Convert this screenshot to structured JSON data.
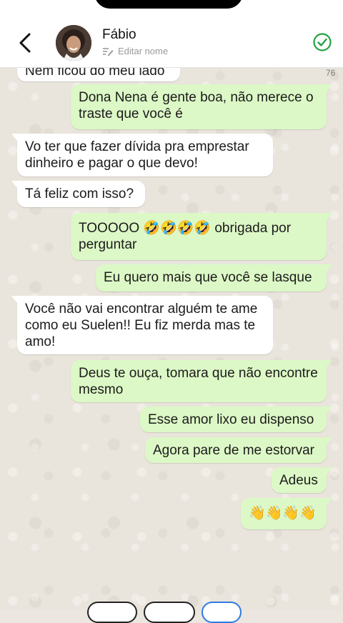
{
  "header": {
    "contact_name": "Fábio",
    "edit_label": "Editar nome",
    "counter": "76"
  },
  "messages": [
    {
      "side": "incoming",
      "text": "Nem ficou do meu lado"
    },
    {
      "side": "outgoing",
      "text": "Dona Nena é gente boa, não merece o traste que você é"
    },
    {
      "side": "incoming",
      "text": "Vo ter que fazer dívida pra emprestar dinheiro e pagar o que devo!"
    },
    {
      "side": "incoming",
      "text": "Tá feliz com isso?"
    },
    {
      "side": "outgoing",
      "text": "TOOOOO 🤣🤣🤣🤣  obrigada por perguntar"
    },
    {
      "side": "outgoing",
      "text": "Eu quero mais que você se lasque"
    },
    {
      "side": "incoming",
      "text": "Você não vai encontrar alguém te ame como eu Suelen!! Eu fiz merda mas te amo!"
    },
    {
      "side": "outgoing",
      "text": "Deus te ouça, tomara que não encontre mesmo"
    },
    {
      "side": "outgoing",
      "text": "Esse amor lixo eu dispenso"
    },
    {
      "side": "outgoing",
      "text": "Agora pare de me estorvar"
    },
    {
      "side": "outgoing",
      "text": "Adeus"
    },
    {
      "side": "outgoing",
      "text": "👋👋👋👋"
    }
  ],
  "colors": {
    "outgoing_bubble": "#dcf8c6",
    "incoming_bubble": "#ffffff",
    "accent": "#25a244"
  }
}
